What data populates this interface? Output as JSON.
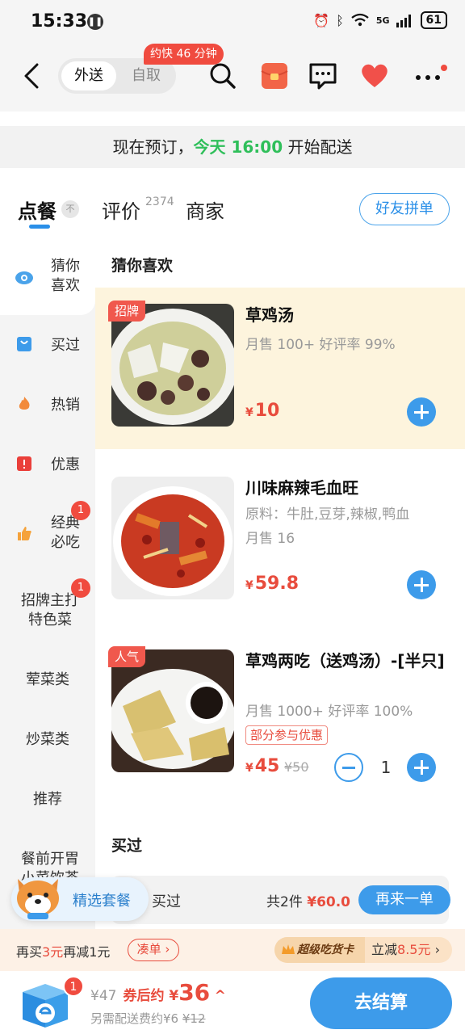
{
  "status": {
    "time": "15:33",
    "battery": "61",
    "network": "5G"
  },
  "nav": {
    "mode_active": "外送",
    "mode_other": "自取",
    "eta": "约快 46 分钟"
  },
  "preorder": {
    "prefix": "现在预订，",
    "day_time": "今天 16:00",
    "suffix": "开始配送"
  },
  "tabs": {
    "order": "点餐",
    "pin": "不",
    "review": "评价",
    "review_count": "2374",
    "merchant": "商家",
    "friend_btn": "好友拼单"
  },
  "sidebar": {
    "items": [
      {
        "label": "猜你喜欢"
      },
      {
        "label": "买过"
      },
      {
        "label": "热销"
      },
      {
        "label": "优惠"
      },
      {
        "label": "经典必吃",
        "badge": "1"
      },
      {
        "label": "招牌主打特色菜",
        "badge": "1"
      },
      {
        "label": "荤菜类"
      },
      {
        "label": "炒菜类"
      },
      {
        "label": "推荐"
      },
      {
        "label": "餐前开胃小菜饮茶"
      }
    ]
  },
  "sections": {
    "guess": "猜你喜欢",
    "bought": "买过"
  },
  "dishes": [
    {
      "tag": "招牌",
      "name": "草鸡汤",
      "meta": "月售 100+  好评率 99%",
      "price_symbol": "¥",
      "price": "10"
    },
    {
      "name": "川味麻辣毛血旺",
      "meta": "原料：牛肚,豆芽,辣椒,鸭血",
      "meta2": "月售 16",
      "price_symbol": "¥",
      "price": "59.8"
    },
    {
      "tag": "人气",
      "name": "草鸡两吃（送鸡汤）-[半只]",
      "meta": "月售 1000+  好评率 100%",
      "promo": "部分参与优惠",
      "price_symbol": "¥",
      "price": "45",
      "orig_price": "¥50",
      "qty": "1"
    }
  ],
  "reorder": {
    "label": "买过",
    "count_prefix": "共2件",
    "amount": "¥60.0",
    "button": "再来一单"
  },
  "combo": {
    "label": "精选套餐"
  },
  "promo": {
    "text_a": "再买",
    "amount_a": "3元",
    "text_b": "再减1元",
    "coudan": "凑单 ›",
    "card_name": "超级吃货卡",
    "card_text": "立减",
    "card_amount": "8.5元",
    "card_arrow": "›"
  },
  "checkout": {
    "badge": "1",
    "orig_total": "¥47",
    "after_label": "券后约 ¥",
    "after_amount": "36",
    "caret": "^",
    "delivery_label": "另需配送费约¥6",
    "delivery_orig": "¥12",
    "button": "去结算"
  },
  "colors": {
    "accent_blue": "#3d9bea",
    "price_red": "#e84c3d",
    "green": "#2fbf5a",
    "highlight_bg": "#fdf4dd"
  }
}
